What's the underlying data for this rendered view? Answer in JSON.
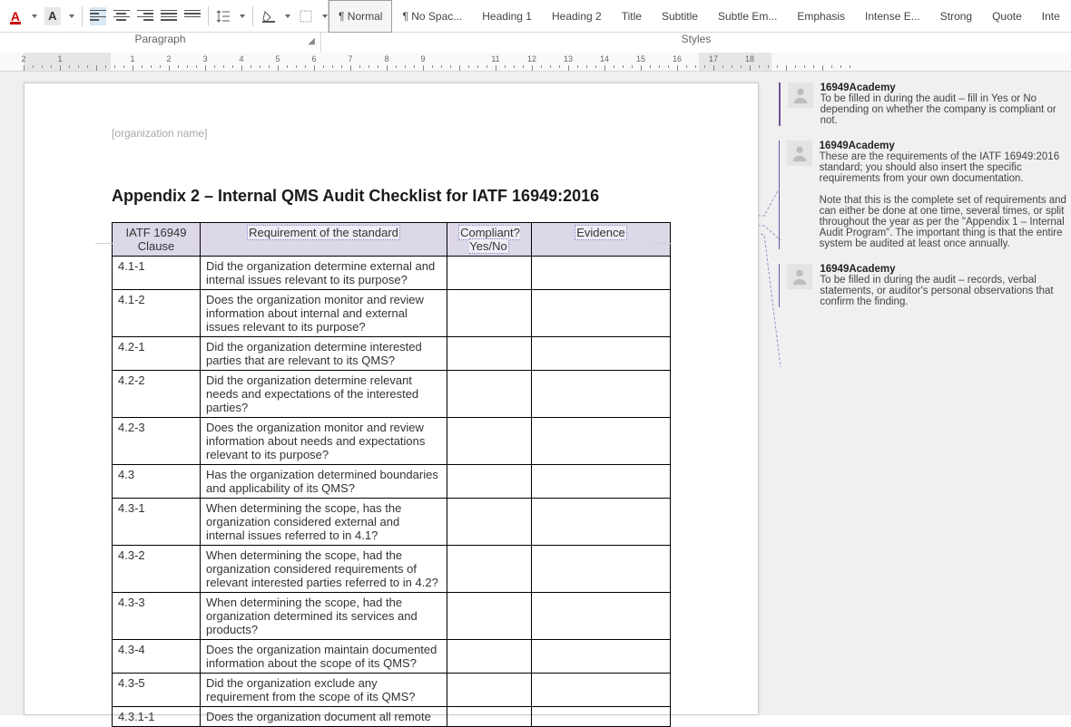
{
  "ribbon": {
    "paragraph_label": "Paragraph",
    "styles_label": "Styles",
    "styles": [
      {
        "label": "¶ Normal",
        "selected": true
      },
      {
        "label": "¶ No Spac..."
      },
      {
        "label": "Heading 1"
      },
      {
        "label": "Heading 2"
      },
      {
        "label": "Title"
      },
      {
        "label": "Subtitle"
      },
      {
        "label": "Subtle Em..."
      },
      {
        "label": "Emphasis"
      },
      {
        "label": "Intense E..."
      },
      {
        "label": "Strong"
      },
      {
        "label": "Quote"
      },
      {
        "label": "Inte"
      }
    ]
  },
  "ruler": {
    "min": -2,
    "max": 18,
    "markers": [
      -2,
      -1,
      1,
      2,
      3,
      4,
      5,
      6,
      7,
      8,
      9,
      11,
      12,
      13,
      14,
      15,
      16,
      17,
      18
    ]
  },
  "document": {
    "header_placeholder": "[organization name]",
    "title": "Appendix 2 – Internal QMS Audit Checklist for IATF 16949:2016",
    "table": {
      "columns": [
        "IATF 16949 Clause",
        "Requirement of the standard",
        "Compliant? Yes/No",
        "Evidence"
      ],
      "rows": [
        {
          "clause": "4.1-1",
          "req": "Did the organization determine external and internal issues relevant to its purpose?"
        },
        {
          "clause": "4.1-2",
          "req": "Does the organization monitor and review information about internal and external issues relevant to its purpose?"
        },
        {
          "clause": "4.2-1",
          "req": "Did the organization determine interested parties that are relevant to its QMS?"
        },
        {
          "clause": "4.2-2",
          "req": "Did the organization determine relevant needs and expectations of the interested parties?"
        },
        {
          "clause": "4.2-3",
          "req": "Does the organization monitor and review information about needs and expectations relevant to its purpose?"
        },
        {
          "clause": "4.3",
          "req": "Has the organization determined boundaries and applicability of its QMS?"
        },
        {
          "clause": "4.3-1",
          "req": "When determining the scope, has the organization considered external and internal issues referred to in 4.1?"
        },
        {
          "clause": "4.3-2",
          "req": "When determining the scope, had the organization considered requirements of relevant interested parties referred to in 4.2?"
        },
        {
          "clause": "4.3-3",
          "req": "When determining the scope, had the organization determined its services and products?"
        },
        {
          "clause": "4.3-4",
          "req": "Does the organization maintain documented information about the scope of its QMS?"
        },
        {
          "clause": "4.3-5",
          "req": "Did the organization exclude any requirement from the scope of its QMS?"
        },
        {
          "clause": "4.3.1-1",
          "req": "Does the organization document all remote"
        }
      ]
    }
  },
  "comments": [
    {
      "author": "16949Academy",
      "text": "To be filled in during the audit – fill in Yes or No depending on whether the company is compliant or not."
    },
    {
      "author": "16949Academy",
      "text": "These are the requirements of the IATF 16949:2016 standard; you should also insert the specific requirements from your own documentation.\n\nNote that this is the complete set of requirements and can either be done at one time, several times, or split throughout the year as per the \"Appendix 1 – Internal Audit Program\". The important thing is that the entire system be audited at least once annually."
    },
    {
      "author": "16949Academy",
      "text": "To be filled in during the audit – records, verbal statements, or auditor's personal observations that confirm the finding."
    }
  ]
}
